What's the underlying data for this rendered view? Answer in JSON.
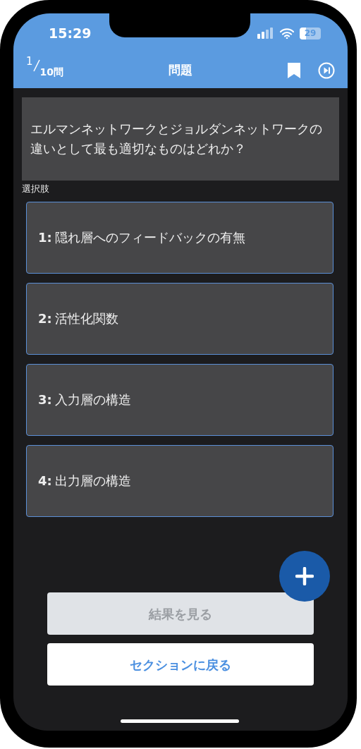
{
  "status_bar": {
    "time": "15:29",
    "battery": "29"
  },
  "header": {
    "numerator": "1",
    "denominator": "10問",
    "title": "問題"
  },
  "question": "エルマンネットワークとジョルダンネットワークの違いとして最も適切なものはどれか？",
  "choices_label": "選択肢",
  "choices": [
    {
      "number": "1:",
      "text": "隠れ層へのフィードバックの有無"
    },
    {
      "number": "2:",
      "text": "活性化関数"
    },
    {
      "number": "3:",
      "text": "入力層の構造"
    },
    {
      "number": "4:",
      "text": "出力層の構造"
    }
  ],
  "buttons": [
    {
      "label": "結果を見る",
      "disabled": true
    },
    {
      "label": "セクションに戻る",
      "disabled": false
    }
  ]
}
